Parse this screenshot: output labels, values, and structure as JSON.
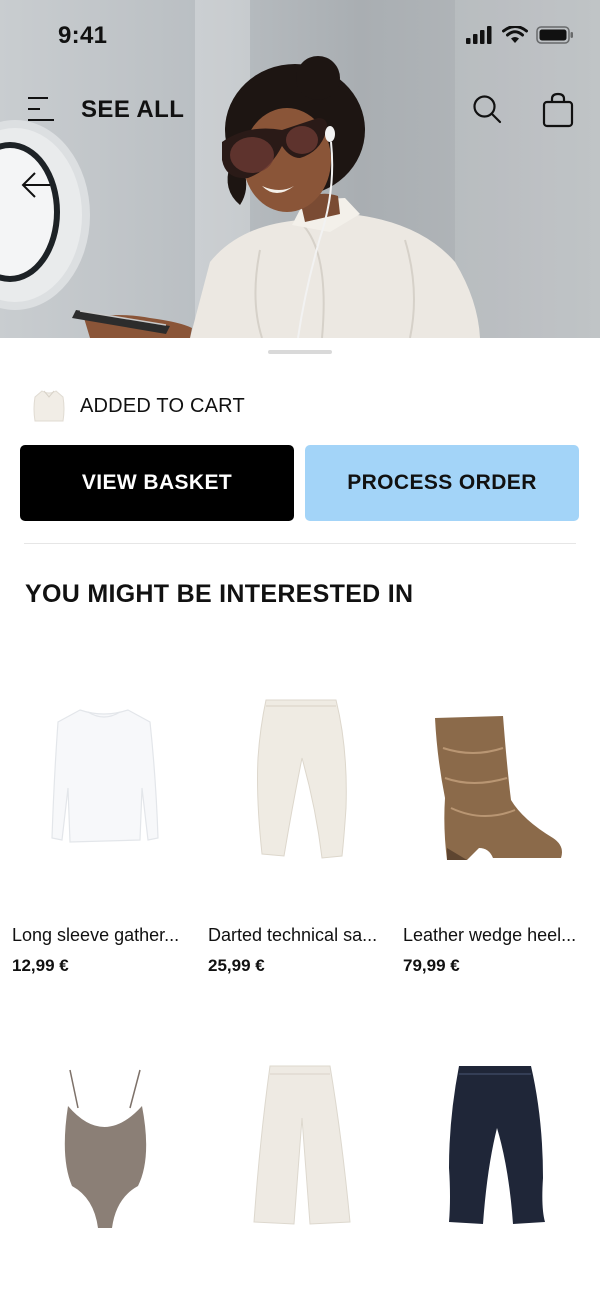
{
  "status_bar": {
    "time": "9:41"
  },
  "header": {
    "title": "SEE ALL"
  },
  "cart": {
    "message": "ADDED TO CART"
  },
  "actions": {
    "view_basket": "VIEW BASKET",
    "process_order": "PROCESS ORDER"
  },
  "recommendations": {
    "title": "YOU MIGHT BE INTERESTED IN",
    "products": [
      {
        "name": "Long sleeve gather...",
        "price": "12,99 €"
      },
      {
        "name": "Darted technical sa...",
        "price": "25,99 €"
      },
      {
        "name": "Leather wedge heel...",
        "price": "79,99 €"
      },
      {
        "name": "",
        "price": ""
      },
      {
        "name": "",
        "price": ""
      },
      {
        "name": "",
        "price": ""
      }
    ]
  },
  "colors": {
    "accent": "#a3d4f8",
    "primary_button": "#000000"
  },
  "icons": [
    "menu-icon",
    "search-icon",
    "shopping-bag-icon",
    "back-arrow-icon",
    "signal-icon",
    "wifi-icon",
    "battery-icon"
  ]
}
